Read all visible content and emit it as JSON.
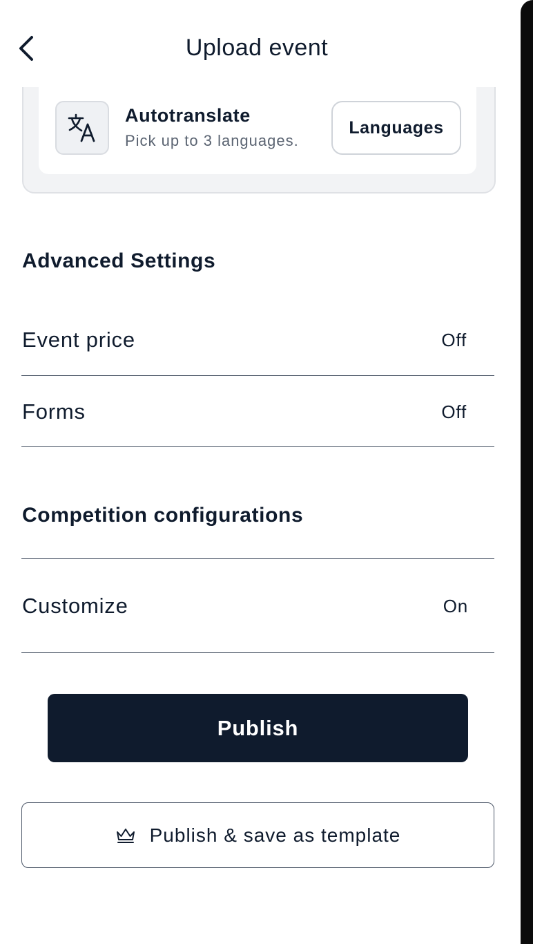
{
  "header": {
    "title": "Upload event",
    "back_icon": "chevron-left-icon"
  },
  "autotranslate": {
    "icon": "translate-icon",
    "title": "Autotranslate",
    "subtitle": "Pick up to 3 languages.",
    "languages_button": "Languages"
  },
  "advanced": {
    "heading": "Advanced Settings",
    "rows": [
      {
        "label": "Event price",
        "value": "Off"
      },
      {
        "label": "Forms",
        "value": "Off"
      }
    ]
  },
  "competition": {
    "heading": "Competition configurations",
    "rows": [
      {
        "label": "Customize",
        "value": "On"
      }
    ]
  },
  "actions": {
    "publish": "Publish",
    "publish_template": "Publish & save as template",
    "template_icon": "crown-icon"
  },
  "colors": {
    "primary": "#0f1b2d",
    "muted_text": "#5b6472",
    "card_bg": "#f2f3f5"
  }
}
